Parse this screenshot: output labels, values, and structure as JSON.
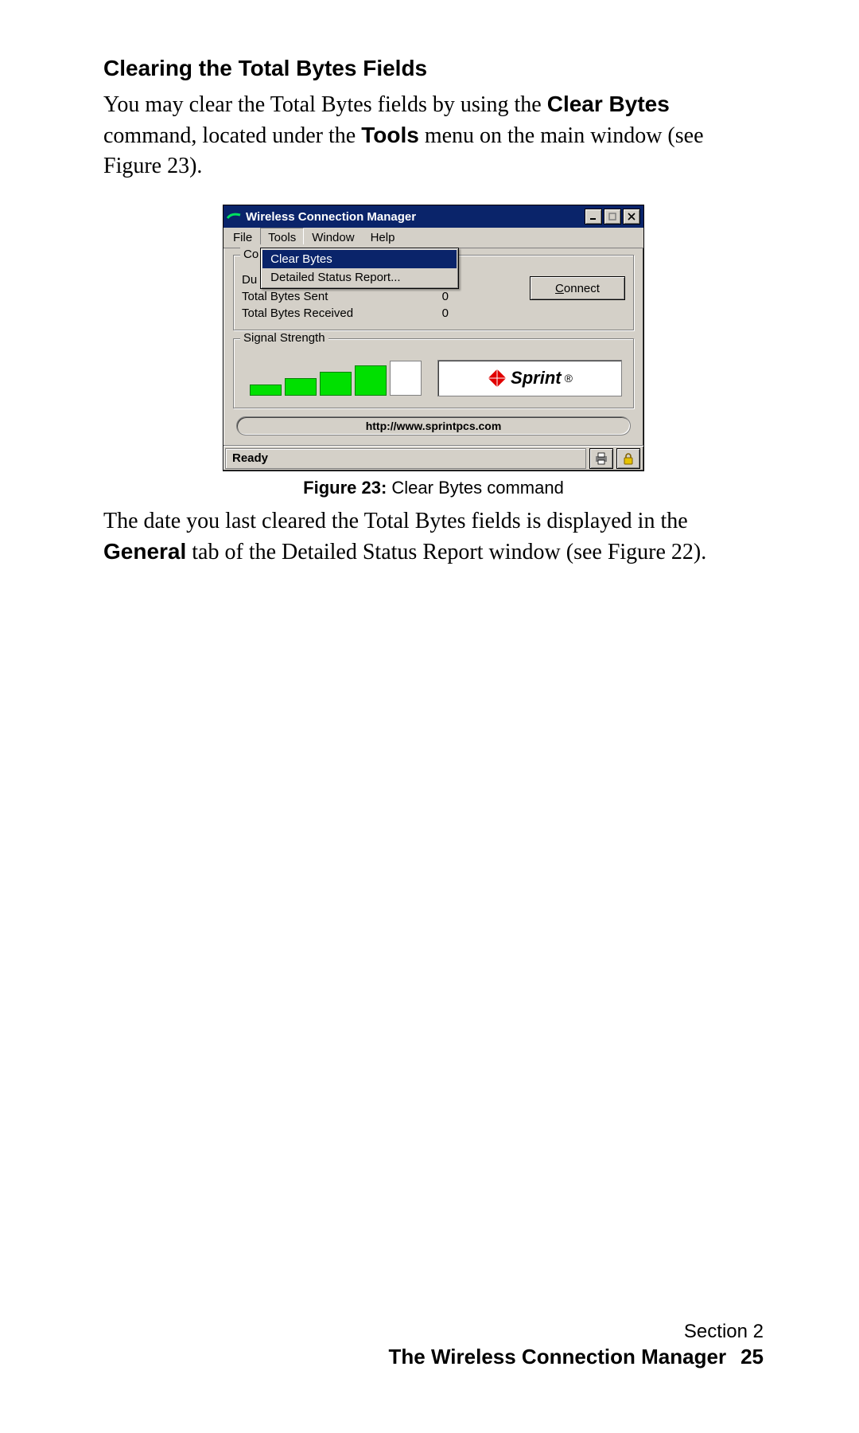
{
  "heading": "Clearing the Total Bytes Fields",
  "para1_a": "You may clear the Total Bytes fields by using the ",
  "para1_b": "Clear Bytes",
  "para1_c": " command, located under the ",
  "para1_d": "Tools",
  "para1_e": " menu on the main window (see Figure 23).",
  "figure": {
    "label": "Figure 23:",
    "caption": " Clear Bytes command",
    "window": {
      "title": "Wireless Connection Manager",
      "menus": {
        "file": "File",
        "tools": "Tools",
        "window": "Window",
        "help": "Help"
      },
      "tools_menu": {
        "clear_bytes": "Clear Bytes",
        "detailed_status": "Detailed Status Report..."
      },
      "group_conn_label": "Co",
      "duration_label_trunc": "Du",
      "sent_label": "Total Bytes Sent",
      "sent_value": "0",
      "recv_label": "Total Bytes Received",
      "recv_value": "0",
      "connect_btn_underline": "C",
      "connect_btn_rest": "onnect",
      "group_signal_label": "Signal Strength",
      "sprint_text": "Sprint",
      "url": "http://www.sprintpcs.com",
      "status": "Ready"
    }
  },
  "para2_a": "The date you last cleared the Total Bytes fields is displayed in the ",
  "para2_b": "General",
  "para2_c": " tab of the Detailed Status Report window (see Figure 22).",
  "footer": {
    "section": "Section 2",
    "title": "The Wireless Connection Manager",
    "page": "25"
  }
}
